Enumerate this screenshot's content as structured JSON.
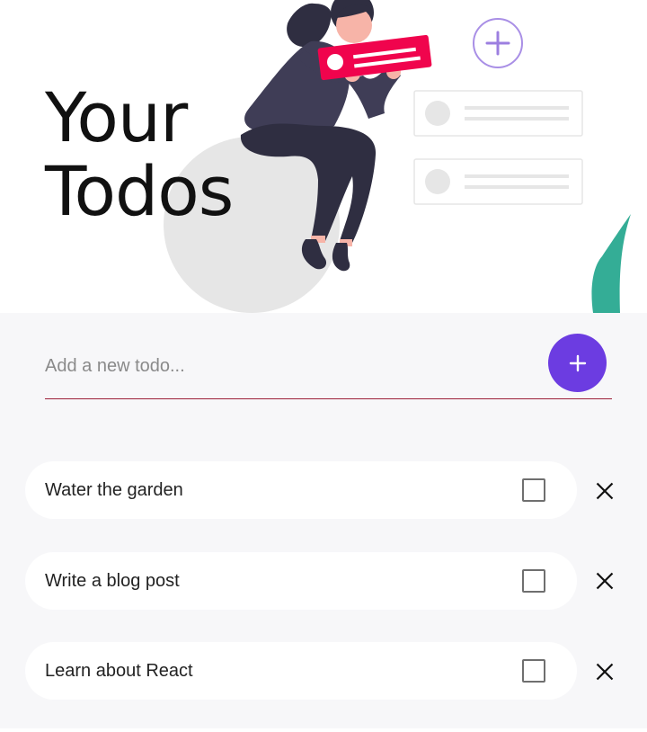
{
  "header": {
    "title_line1": "Your",
    "title_line2": "Todos"
  },
  "new_todo": {
    "placeholder": "Add a new todo...",
    "value": "",
    "add_icon": "plus-icon"
  },
  "todos": [
    {
      "text": "Water the garden",
      "completed": false
    },
    {
      "text": "Write a blog post",
      "completed": false
    },
    {
      "text": "Learn about React",
      "completed": false
    }
  ],
  "colors": {
    "accent": "#6c3ce1",
    "underline": "#9c1f3a",
    "card_red": "#f0044d",
    "plant": "#34ad96",
    "panel_bg": "#f7f7f9"
  }
}
